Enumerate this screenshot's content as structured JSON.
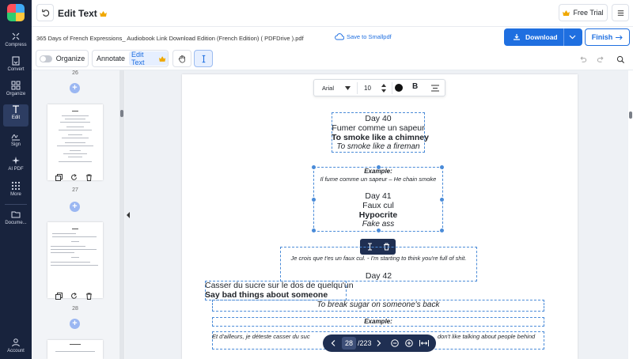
{
  "rail": {
    "items": [
      {
        "label": "Compress",
        "icon": "compress-icon"
      },
      {
        "label": "Convert",
        "icon": "convert-icon"
      },
      {
        "label": "Organize",
        "icon": "organize-icon"
      },
      {
        "label": "Edit",
        "icon": "edit-icon"
      },
      {
        "label": "Sign",
        "icon": "sign-icon"
      },
      {
        "label": "AI PDF",
        "icon": "ai-sparkle-icon"
      },
      {
        "label": "More",
        "icon": "grid-icon"
      },
      {
        "label": "Docume...",
        "icon": "folder-icon"
      }
    ],
    "account_label": "Account"
  },
  "header": {
    "title": "Edit Text",
    "free_trial": "Free Trial"
  },
  "file": {
    "name": "365 Days of French Expressions_ Audiobook Link Download Edition (French Edition) ( PDFDrive ).pdf",
    "save_link": "Save to Smallpdf",
    "download": "Download",
    "finish": "Finish"
  },
  "toolbar": {
    "organize": "Organize",
    "annotate": "Annotate",
    "edit_text": "Edit Text"
  },
  "thumbnails": {
    "pages": [
      "26",
      "27",
      "28"
    ]
  },
  "format": {
    "font": "Arial",
    "size": "10",
    "bold": "B"
  },
  "content": {
    "day40": "Day 40",
    "fumer": "Fumer comme un sapeur",
    "smoke_bold": "To smoke like a chimney",
    "smoke_italic": "To smoke like a fireman",
    "example1": "Example:",
    "example1_text": "Il fume comme un sapeur – He chain smoke",
    "day41": "Day 41",
    "faux": "Faux cul",
    "hypocrite": "Hypocrite",
    "fake": "Fake ass",
    "je_crois": "Je crois que t'es un faux cul. - I'm starting to think you're full of shit.",
    "day42": "Day 42",
    "casser": "Casser du sucre sur le dos de quelqu'un",
    "say_bad": "Say bad things about someone",
    "break_sugar": "To break sugar on someone's back",
    "example2": "Example:",
    "et_ailleurs_a": "Et d'ailleurs, je déteste casser du suc",
    "et_ailleurs_b": "don't like talking about people behind"
  },
  "pager": {
    "current": "28",
    "total": "/223"
  },
  "colors": {
    "rail": "#18233d",
    "accent": "#1f6fe0",
    "selection": "#4a8bd8",
    "pager": "#1f2f52"
  }
}
